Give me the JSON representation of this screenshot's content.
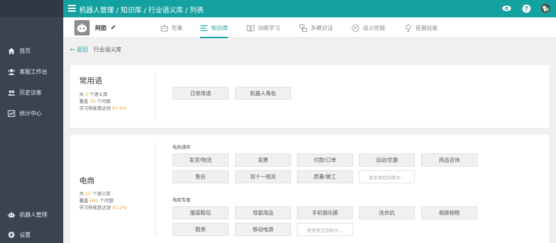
{
  "header": {
    "breadcrumb": "机器人管理 / 知识库 / 行业语义库 / 列表"
  },
  "sidebar": {
    "items": [
      {
        "label": "首页",
        "icon": "home-icon"
      },
      {
        "label": "客服工作台",
        "icon": "agent-icon"
      },
      {
        "label": "历史访客",
        "icon": "users-icon"
      },
      {
        "label": "统计中心",
        "icon": "chart-icon"
      },
      {
        "label": "机器人管理",
        "icon": "robot-icon"
      },
      {
        "label": "设置",
        "icon": "gear-icon"
      }
    ]
  },
  "robot": {
    "name": "阿团"
  },
  "tabs": [
    {
      "label": "形象",
      "icon": "robot-face-icon",
      "active": false
    },
    {
      "label": "知识库",
      "icon": "list-icon",
      "active": true
    },
    {
      "label": "训练学习",
      "icon": "book-icon",
      "active": false
    },
    {
      "label": "多模对话",
      "icon": "dialog-icon",
      "active": false
    },
    {
      "label": "语义挖掘",
      "icon": "mining-icon",
      "active": false
    },
    {
      "label": "拓展技能",
      "icon": "skill-icon",
      "active": false
    }
  ],
  "subcrumb": {
    "back": "← 返回",
    "current": "行业语义库"
  },
  "cards": {
    "common": {
      "title": "常用语",
      "stat1_pre": "共",
      "stat1_num": "2",
      "stat1_post": "个语义库",
      "stat2_pre": "覆盖",
      "stat2_num": "20",
      "stat2_post": "个问题",
      "stat3_pre": "学习熟练度达到",
      "stat3_num": "87.6%",
      "tags": [
        "日常用语",
        "机器人角色"
      ]
    },
    "ecommerce": {
      "title": "电商",
      "stat1_pre": "共",
      "stat1_num": "15",
      "stat1_post": "个语义库",
      "stat2_pre": "覆盖",
      "stat2_num": "691",
      "stat2_post": "个问题",
      "stat3_pre": "学习熟练度达到",
      "stat3_num": "91.2%",
      "section1": "电商通用",
      "section1_tags": [
        "发货/物流",
        "发票",
        "付款/订单",
        "活动/优惠",
        "商品咨询",
        "售后",
        "双十一相关",
        "质量/做工"
      ],
      "section1_more": "更多类目训练中...",
      "section2": "电商专属",
      "section2_tags": [
        "服装鞋包",
        "母婴用品",
        "手机钢化膜",
        "洗衣机",
        "相册相框",
        "鞋类",
        "移动电源"
      ],
      "section2_more": "更多类目训练中..."
    }
  },
  "colors": {
    "accent": "#14a2a0",
    "sidebar": "#3a4451",
    "highlight": "#f0a020"
  }
}
